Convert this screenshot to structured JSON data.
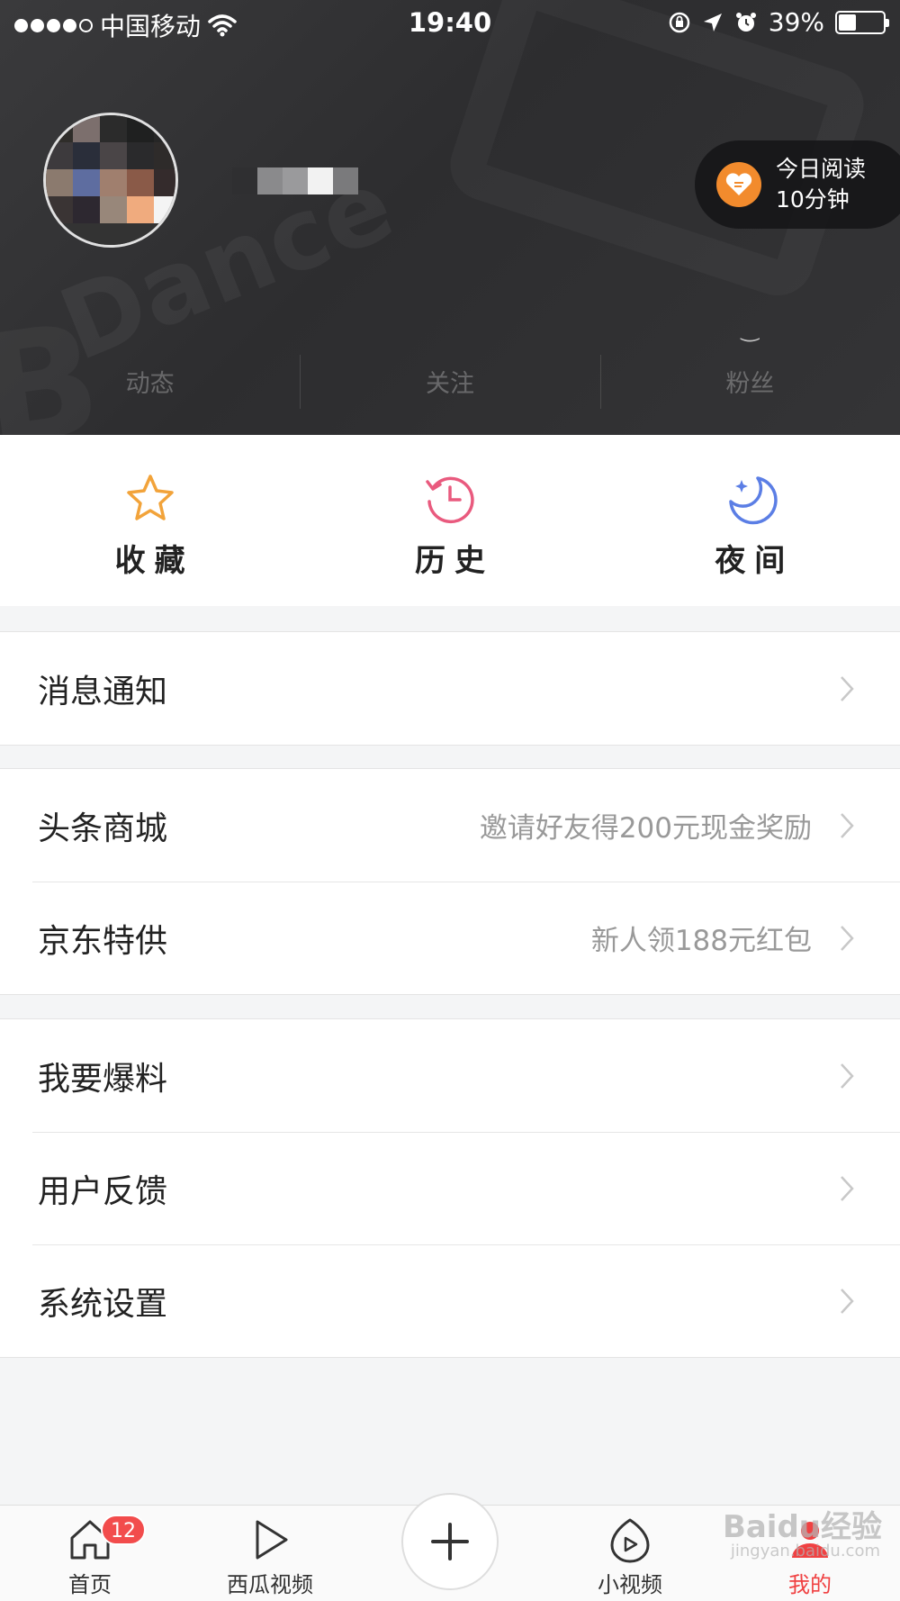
{
  "status_bar": {
    "carrier": "中国移动",
    "time": "19:40",
    "battery": "39%"
  },
  "reading_badge": {
    "line1": "今日阅读",
    "line2": "10分钟"
  },
  "stats": [
    {
      "label": "动态",
      "value": ""
    },
    {
      "label": "关注",
      "value": ""
    },
    {
      "label": "粉丝",
      "value": "‿"
    }
  ],
  "quick_actions": [
    {
      "label": "收藏",
      "icon": "star-icon",
      "color": "#f2a33a"
    },
    {
      "label": "历史",
      "icon": "clock-history-icon",
      "color": "#e95a7e"
    },
    {
      "label": "夜间",
      "icon": "moon-icon",
      "color": "#5b7ee5"
    }
  ],
  "menu_groups": [
    [
      {
        "label": "消息通知",
        "sub": ""
      }
    ],
    [
      {
        "label": "头条商城",
        "sub": "邀请好友得200元现金奖励"
      },
      {
        "label": "京东特供",
        "sub": "新人领188元红包"
      }
    ],
    [
      {
        "label": "我要爆料",
        "sub": ""
      },
      {
        "label": "用户反馈",
        "sub": ""
      },
      {
        "label": "系统设置",
        "sub": ""
      }
    ]
  ],
  "tabs": [
    {
      "label": "首页",
      "icon": "home-icon",
      "badge": "12"
    },
    {
      "label": "西瓜视频",
      "icon": "play-icon",
      "badge": ""
    },
    {
      "label": "小视频",
      "icon": "short-video-icon",
      "badge": ""
    },
    {
      "label": "我的",
      "icon": "profile-icon",
      "badge": ""
    }
  ],
  "watermark": {
    "brand": "Baidu经验",
    "url": "jingyan.baidu.com"
  },
  "colors": {
    "header_bg": "#333335",
    "accent_red": "#f04142",
    "badge_orange": "#f28b2d"
  }
}
